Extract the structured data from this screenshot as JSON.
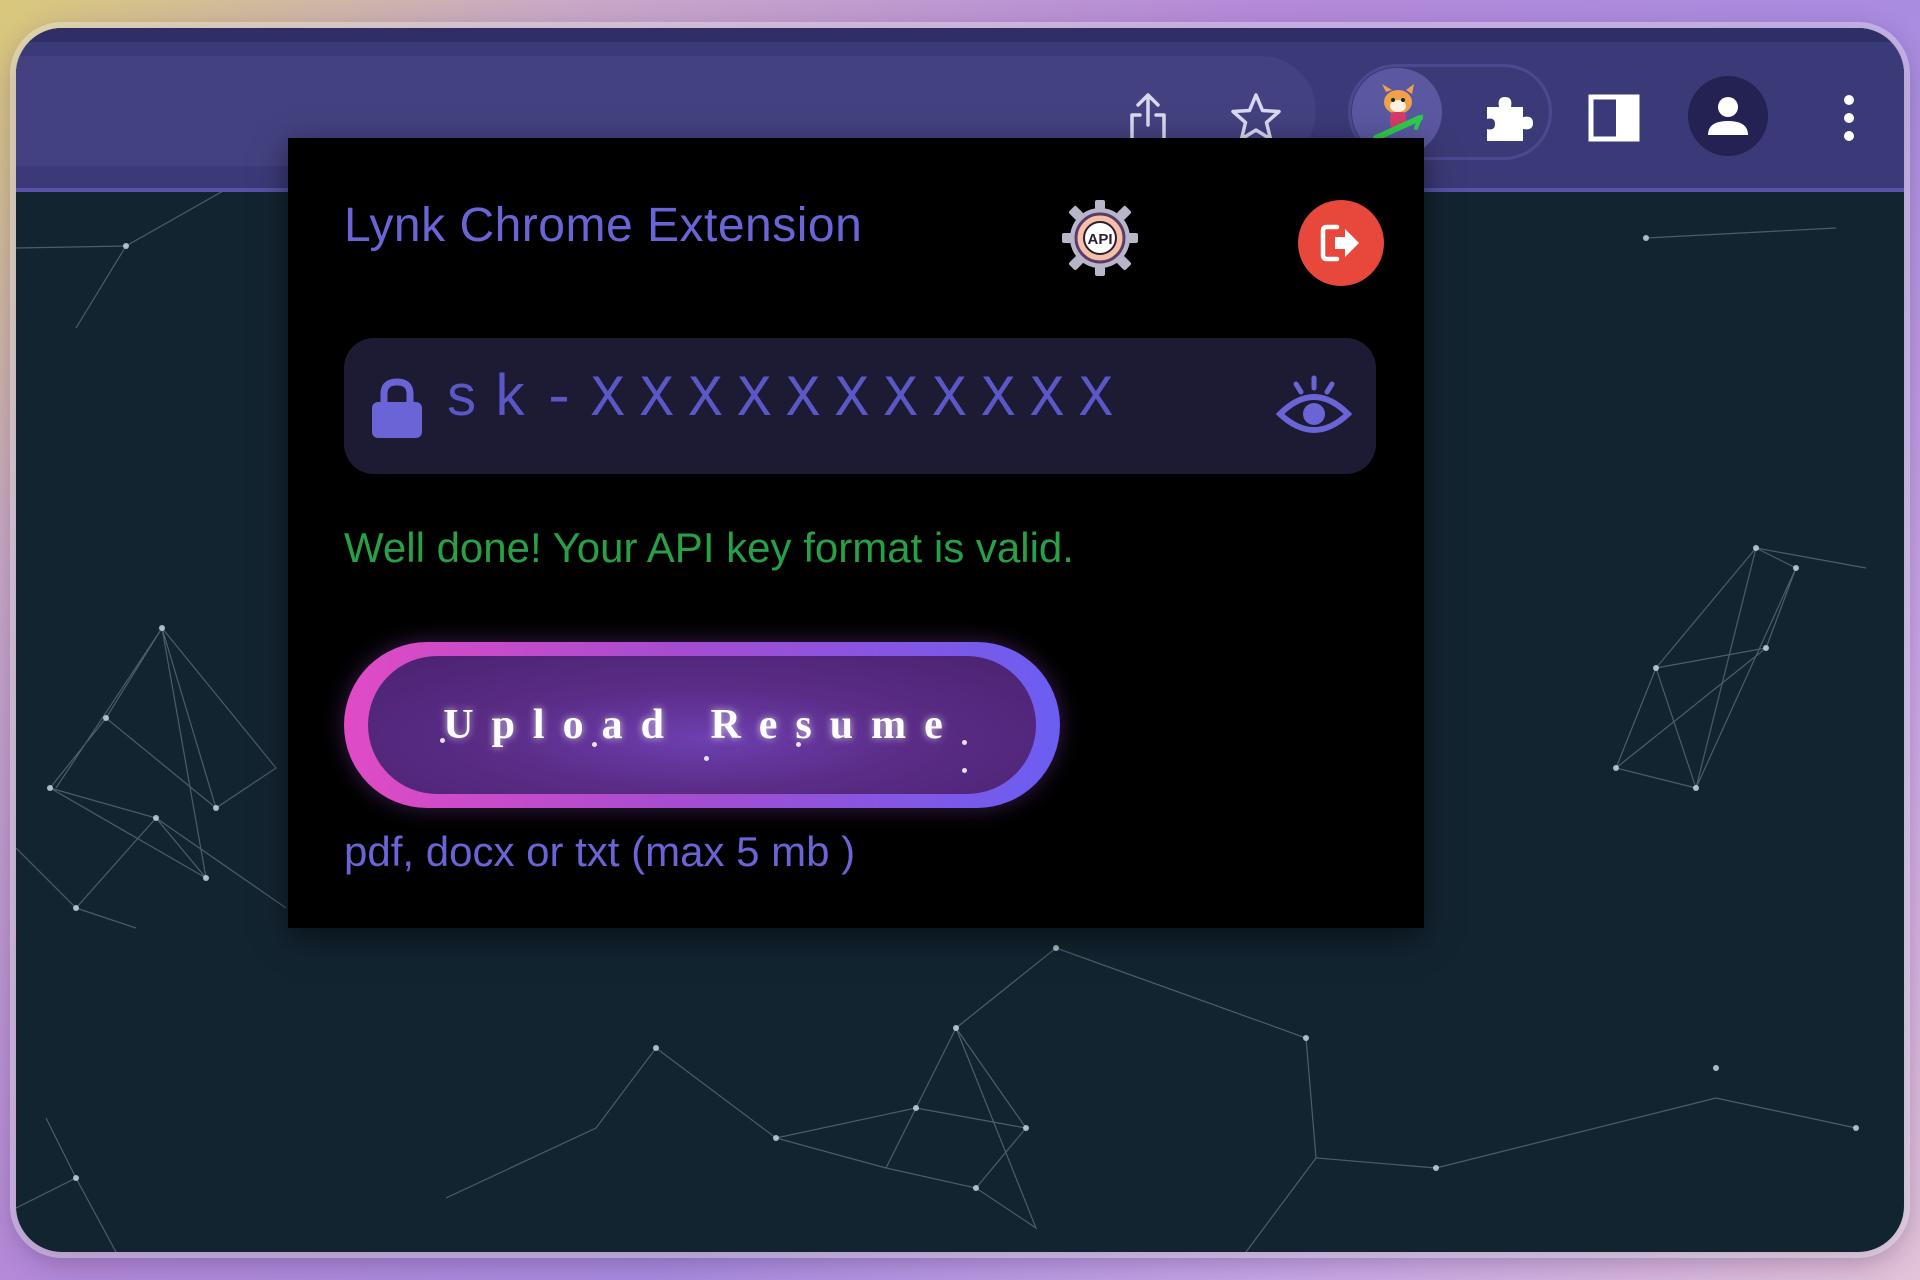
{
  "toolbar": {
    "buttons": [
      {
        "name": "share-icon",
        "label": "Share"
      },
      {
        "name": "star-icon",
        "label": "Bookmark"
      },
      {
        "name": "lynk-extension-icon",
        "label": "Lynk extension"
      },
      {
        "name": "puzzle-icon",
        "label": "Extensions"
      },
      {
        "name": "side-panel-icon",
        "label": "Side panel"
      },
      {
        "name": "profile-icon",
        "label": "Profile"
      },
      {
        "name": "more-vert-icon",
        "label": "More"
      }
    ]
  },
  "popup": {
    "title": "Lynk Chrome Extension",
    "api_badge": "API",
    "api_icon": "api-gear-icon",
    "logout_icon": "logout-icon",
    "key_field": {
      "value": "sk-XXXXXXXXXXX",
      "lock_icon": "lock-icon",
      "visibility_icon": "eye-icon"
    },
    "status_message": "Well done! Your API key format is valid.",
    "upload_button_label": "Upload Resume",
    "file_hint": "pdf, docx or txt (max 5 mb )"
  },
  "colors": {
    "accent": "#6a64d6",
    "success": "#27a046",
    "logout": "#e8483c",
    "popup_bg": "#000000",
    "toolbar_bg": "#3b3a78"
  }
}
